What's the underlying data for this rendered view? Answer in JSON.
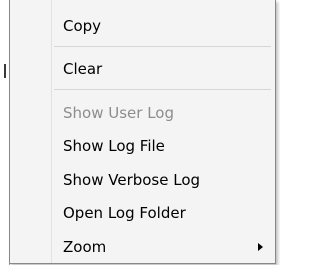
{
  "context_menu": {
    "items": [
      {
        "label": "Copy",
        "enabled": true
      },
      {
        "label": "Clear",
        "enabled": true
      },
      {
        "label": "Show User Log",
        "enabled": false
      },
      {
        "label": "Show Log File",
        "enabled": true
      },
      {
        "label": "Show Verbose Log",
        "enabled": true
      },
      {
        "label": "Open Log Folder",
        "enabled": true
      },
      {
        "label": "Zoom",
        "enabled": true,
        "submenu_icon": "chevron-right-icon"
      }
    ]
  }
}
